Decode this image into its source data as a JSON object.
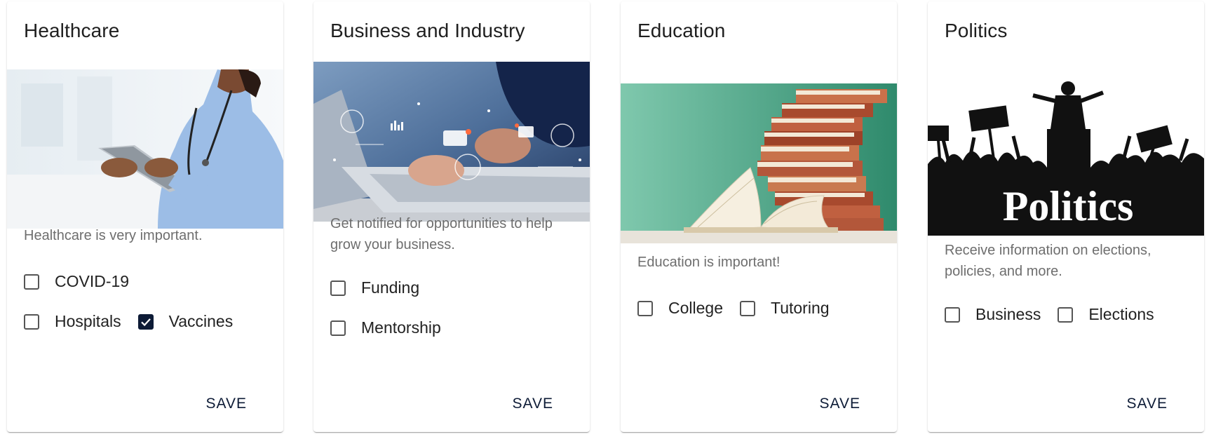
{
  "cards": [
    {
      "title": "Healthcare",
      "description": "Healthcare is very important.",
      "image": "nurse-with-tablet-photo",
      "options": [
        {
          "label": "COVID-19",
          "checked": false
        },
        {
          "label": "Hospitals",
          "checked": false
        },
        {
          "label": "Vaccines",
          "checked": true
        }
      ],
      "save_label": "SAVE"
    },
    {
      "title": "Business and Industry",
      "description": "Get notified for opportunities to help grow your business.",
      "image": "laptop-typing-photo",
      "options": [
        {
          "label": "Funding",
          "checked": false
        },
        {
          "label": "Mentorship",
          "checked": false
        }
      ],
      "save_label": "SAVE"
    },
    {
      "title": "Education",
      "description": "Education is important!",
      "image": "book-stack-photo",
      "options": [
        {
          "label": "College",
          "checked": false
        },
        {
          "label": "Tutoring",
          "checked": false
        }
      ],
      "save_label": "SAVE"
    },
    {
      "title": "Politics",
      "description": "Receive information on elections, policies, and more.",
      "image": "politics-crowd-illustration",
      "image_text": "Politics",
      "options": [
        {
          "label": "Business",
          "checked": false
        },
        {
          "label": "Elections",
          "checked": false
        }
      ],
      "save_label": "SAVE"
    }
  ],
  "colors": {
    "accent": "#0d1b36",
    "description_text": "#6e6e6e",
    "checkbox_border": "#555555"
  }
}
